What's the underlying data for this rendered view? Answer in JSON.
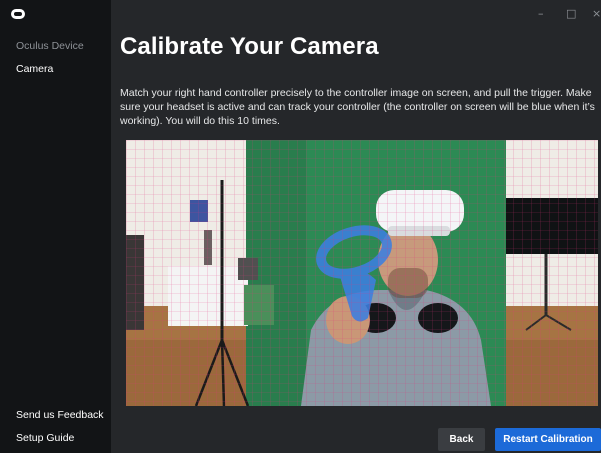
{
  "sidebar": {
    "items": [
      {
        "label": "Oculus Device"
      },
      {
        "label": "Camera"
      }
    ],
    "footer": [
      {
        "label": "Send us Feedback"
      },
      {
        "label": "Setup Guide"
      }
    ]
  },
  "window_controls": {
    "minimize": "–",
    "maximize": "□",
    "close": "×"
  },
  "main": {
    "title": "Calibrate Your Camera",
    "description": "Match your right hand controller precisely to the controller image on screen, and pull the trigger. Make sure your headset is active and can track your controller (the controller on screen will be blue when it’s working). You will do this 10 times."
  },
  "buttons": {
    "back": "Back",
    "restart": "Restart Calibration"
  },
  "colors": {
    "sidebar_bg": "#121416",
    "main_bg": "#25272a",
    "accent": "#1c6ad8",
    "controller_overlay": "#3d7fe0"
  }
}
